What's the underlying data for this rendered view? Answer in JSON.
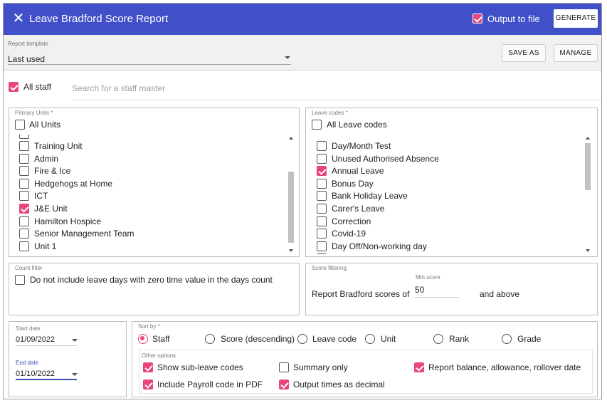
{
  "header": {
    "title": "Leave Bradford Score Report",
    "close_icon": "close-icon",
    "output_to_file_label": "Output to file",
    "output_to_file_checked": true,
    "generate_label": "GENERATE"
  },
  "template": {
    "caption": "Report template",
    "value": "Last used",
    "save_as_label": "SAVE AS",
    "manage_label": "MANAGE"
  },
  "staff": {
    "all_staff_label": "All staff",
    "all_staff_checked": true,
    "search_placeholder": "Search for a staff master"
  },
  "primary_units": {
    "caption": "Primary Units *",
    "all_label": "All Units",
    "items": [
      {
        "label": "Training Unit",
        "checked": false
      },
      {
        "label": "Admin",
        "checked": false
      },
      {
        "label": "Fire & Ice",
        "checked": false
      },
      {
        "label": "Hedgehogs at Home",
        "checked": false
      },
      {
        "label": "ICT",
        "checked": false
      },
      {
        "label": "J&E Unit",
        "checked": true
      },
      {
        "label": "Hamilton Hospice",
        "checked": false
      },
      {
        "label": "Senior Management Team",
        "checked": false
      },
      {
        "label": "Unit 1",
        "checked": false
      }
    ]
  },
  "leave_codes": {
    "caption": "Leave codes *",
    "all_label": "All Leave codes",
    "items": [
      {
        "label": "Day/Month Test",
        "checked": false
      },
      {
        "label": "Unused Authorised Absence",
        "checked": false
      },
      {
        "label": "Annual Leave",
        "checked": true
      },
      {
        "label": "Bonus Day",
        "checked": false
      },
      {
        "label": "Bank Holiday Leave",
        "checked": false
      },
      {
        "label": "Carer's Leave",
        "checked": false
      },
      {
        "label": "Correction",
        "checked": false
      },
      {
        "label": "Covid-19",
        "checked": false
      },
      {
        "label": "Day Off/Non-working day",
        "checked": false
      }
    ]
  },
  "count_filter": {
    "caption": "Count filter",
    "option_label": "Do not include leave days with zero time value in the days count",
    "option_checked": false
  },
  "score_filtering": {
    "caption": "Score filtering",
    "min_score_caption": "Min score",
    "prefix": "Report Bradford scores of",
    "min_score": "50",
    "suffix": "and above"
  },
  "dates": {
    "start_caption": "Start date",
    "start_value": "01/09/2022",
    "end_caption": "End date",
    "end_value": "01/10/2022"
  },
  "sort": {
    "caption": "Sort by *",
    "options": [
      {
        "label": "Staff",
        "selected": true
      },
      {
        "label": "Score (descending)",
        "selected": false
      },
      {
        "label": "Leave code",
        "selected": false
      },
      {
        "label": "Unit",
        "selected": false
      },
      {
        "label": "Rank",
        "selected": false
      },
      {
        "label": "Grade",
        "selected": false
      }
    ]
  },
  "other_options": {
    "caption": "Other options",
    "items": [
      {
        "label": "Show sub-leave codes",
        "checked": true
      },
      {
        "label": "Summary only",
        "checked": false
      },
      {
        "label": "Report balance, allowance, rollover date",
        "checked": true
      },
      {
        "label": "Include Payroll code in PDF",
        "checked": true
      },
      {
        "label": "Output times as decimal",
        "checked": true
      }
    ]
  },
  "colors": {
    "header_bg": "#4150c8",
    "accent": "#e8457a",
    "focus": "#3f51b5"
  }
}
